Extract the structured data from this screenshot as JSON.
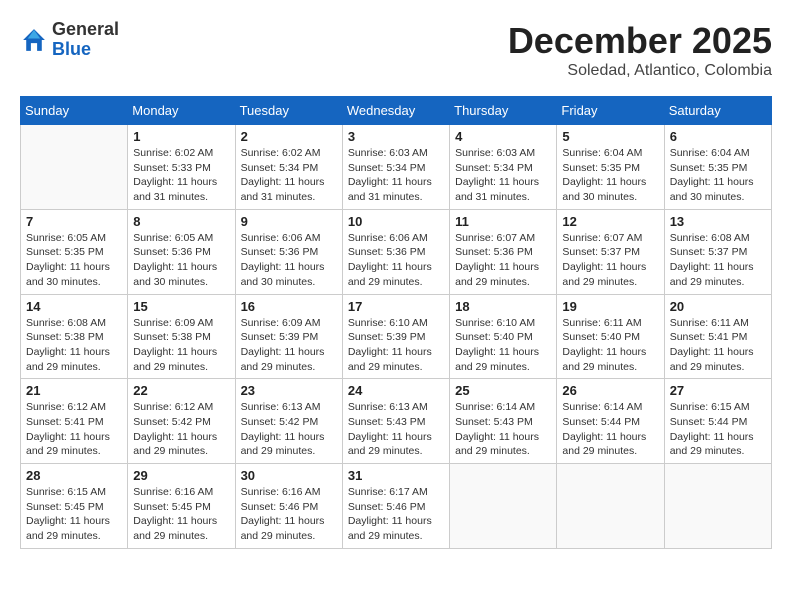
{
  "header": {
    "logo_general": "General",
    "logo_blue": "Blue",
    "month_title": "December 2025",
    "location": "Soledad, Atlantico, Colombia"
  },
  "days_of_week": [
    "Sunday",
    "Monday",
    "Tuesday",
    "Wednesday",
    "Thursday",
    "Friday",
    "Saturday"
  ],
  "weeks": [
    [
      {
        "day": "",
        "info": ""
      },
      {
        "day": "1",
        "info": "Sunrise: 6:02 AM\nSunset: 5:33 PM\nDaylight: 11 hours\nand 31 minutes."
      },
      {
        "day": "2",
        "info": "Sunrise: 6:02 AM\nSunset: 5:34 PM\nDaylight: 11 hours\nand 31 minutes."
      },
      {
        "day": "3",
        "info": "Sunrise: 6:03 AM\nSunset: 5:34 PM\nDaylight: 11 hours\nand 31 minutes."
      },
      {
        "day": "4",
        "info": "Sunrise: 6:03 AM\nSunset: 5:34 PM\nDaylight: 11 hours\nand 31 minutes."
      },
      {
        "day": "5",
        "info": "Sunrise: 6:04 AM\nSunset: 5:35 PM\nDaylight: 11 hours\nand 30 minutes."
      },
      {
        "day": "6",
        "info": "Sunrise: 6:04 AM\nSunset: 5:35 PM\nDaylight: 11 hours\nand 30 minutes."
      }
    ],
    [
      {
        "day": "7",
        "info": "Sunrise: 6:05 AM\nSunset: 5:35 PM\nDaylight: 11 hours\nand 30 minutes."
      },
      {
        "day": "8",
        "info": "Sunrise: 6:05 AM\nSunset: 5:36 PM\nDaylight: 11 hours\nand 30 minutes."
      },
      {
        "day": "9",
        "info": "Sunrise: 6:06 AM\nSunset: 5:36 PM\nDaylight: 11 hours\nand 30 minutes."
      },
      {
        "day": "10",
        "info": "Sunrise: 6:06 AM\nSunset: 5:36 PM\nDaylight: 11 hours\nand 29 minutes."
      },
      {
        "day": "11",
        "info": "Sunrise: 6:07 AM\nSunset: 5:36 PM\nDaylight: 11 hours\nand 29 minutes."
      },
      {
        "day": "12",
        "info": "Sunrise: 6:07 AM\nSunset: 5:37 PM\nDaylight: 11 hours\nand 29 minutes."
      },
      {
        "day": "13",
        "info": "Sunrise: 6:08 AM\nSunset: 5:37 PM\nDaylight: 11 hours\nand 29 minutes."
      }
    ],
    [
      {
        "day": "14",
        "info": "Sunrise: 6:08 AM\nSunset: 5:38 PM\nDaylight: 11 hours\nand 29 minutes."
      },
      {
        "day": "15",
        "info": "Sunrise: 6:09 AM\nSunset: 5:38 PM\nDaylight: 11 hours\nand 29 minutes."
      },
      {
        "day": "16",
        "info": "Sunrise: 6:09 AM\nSunset: 5:39 PM\nDaylight: 11 hours\nand 29 minutes."
      },
      {
        "day": "17",
        "info": "Sunrise: 6:10 AM\nSunset: 5:39 PM\nDaylight: 11 hours\nand 29 minutes."
      },
      {
        "day": "18",
        "info": "Sunrise: 6:10 AM\nSunset: 5:40 PM\nDaylight: 11 hours\nand 29 minutes."
      },
      {
        "day": "19",
        "info": "Sunrise: 6:11 AM\nSunset: 5:40 PM\nDaylight: 11 hours\nand 29 minutes."
      },
      {
        "day": "20",
        "info": "Sunrise: 6:11 AM\nSunset: 5:41 PM\nDaylight: 11 hours\nand 29 minutes."
      }
    ],
    [
      {
        "day": "21",
        "info": "Sunrise: 6:12 AM\nSunset: 5:41 PM\nDaylight: 11 hours\nand 29 minutes."
      },
      {
        "day": "22",
        "info": "Sunrise: 6:12 AM\nSunset: 5:42 PM\nDaylight: 11 hours\nand 29 minutes."
      },
      {
        "day": "23",
        "info": "Sunrise: 6:13 AM\nSunset: 5:42 PM\nDaylight: 11 hours\nand 29 minutes."
      },
      {
        "day": "24",
        "info": "Sunrise: 6:13 AM\nSunset: 5:43 PM\nDaylight: 11 hours\nand 29 minutes."
      },
      {
        "day": "25",
        "info": "Sunrise: 6:14 AM\nSunset: 5:43 PM\nDaylight: 11 hours\nand 29 minutes."
      },
      {
        "day": "26",
        "info": "Sunrise: 6:14 AM\nSunset: 5:44 PM\nDaylight: 11 hours\nand 29 minutes."
      },
      {
        "day": "27",
        "info": "Sunrise: 6:15 AM\nSunset: 5:44 PM\nDaylight: 11 hours\nand 29 minutes."
      }
    ],
    [
      {
        "day": "28",
        "info": "Sunrise: 6:15 AM\nSunset: 5:45 PM\nDaylight: 11 hours\nand 29 minutes."
      },
      {
        "day": "29",
        "info": "Sunrise: 6:16 AM\nSunset: 5:45 PM\nDaylight: 11 hours\nand 29 minutes."
      },
      {
        "day": "30",
        "info": "Sunrise: 6:16 AM\nSunset: 5:46 PM\nDaylight: 11 hours\nand 29 minutes."
      },
      {
        "day": "31",
        "info": "Sunrise: 6:17 AM\nSunset: 5:46 PM\nDaylight: 11 hours\nand 29 minutes."
      },
      {
        "day": "",
        "info": ""
      },
      {
        "day": "",
        "info": ""
      },
      {
        "day": "",
        "info": ""
      }
    ]
  ]
}
